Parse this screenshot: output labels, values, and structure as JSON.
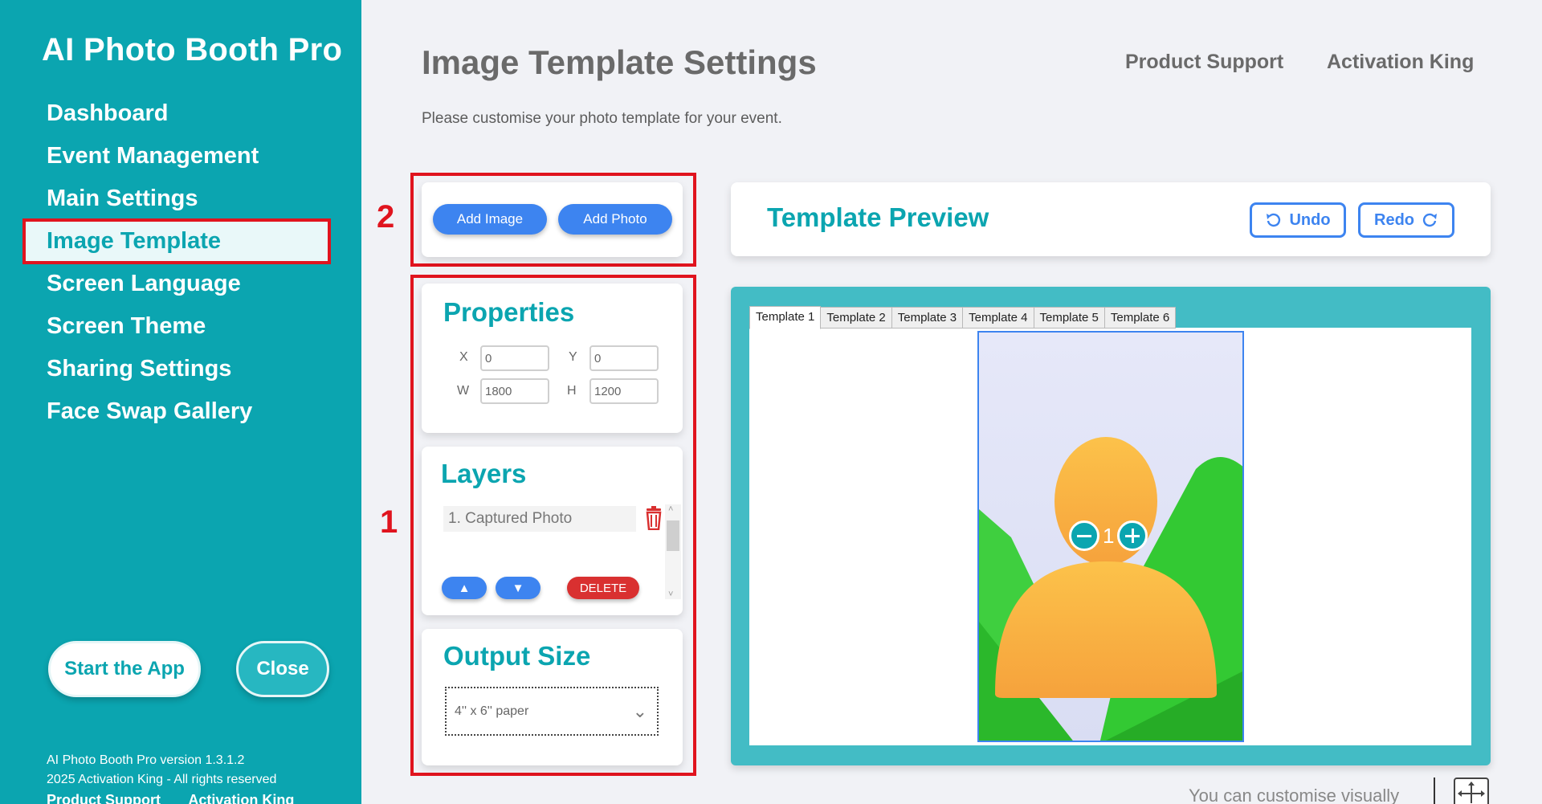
{
  "app": {
    "title": "AI Photo Booth Pro"
  },
  "sidebar": {
    "items": [
      {
        "label": "Dashboard"
      },
      {
        "label": "Event Management"
      },
      {
        "label": "Main Settings"
      },
      {
        "label": "Image Template",
        "active": true
      },
      {
        "label": "Screen Language"
      },
      {
        "label": "Screen Theme"
      },
      {
        "label": "Sharing Settings"
      },
      {
        "label": "Face Swap Gallery"
      }
    ],
    "start_label": "Start the App",
    "close_label": "Close",
    "version": "AI Photo Booth Pro version 1.3.1.2",
    "copyright": "2025 Activation King - All rights reserved",
    "footer_links": [
      "Product Support",
      "Activation King"
    ]
  },
  "header": {
    "title": "Image Template Settings",
    "subtitle": "Please customise your photo template for your event.",
    "links": [
      "Product Support",
      "Activation King"
    ]
  },
  "annotations": {
    "marker_1": "1",
    "marker_2": "2"
  },
  "actions": {
    "add_image": "Add Image",
    "add_photo": "Add Photo"
  },
  "properties": {
    "title": "Properties",
    "x_label": "X",
    "x_value": "0",
    "y_label": "Y",
    "y_value": "0",
    "w_label": "W",
    "w_value": "1800",
    "h_label": "H",
    "h_value": "1200"
  },
  "layers": {
    "title": "Layers",
    "items": [
      "1. Captured Photo"
    ],
    "up_label": "▲",
    "down_label": "▼",
    "delete_label": "DELETE"
  },
  "output": {
    "title": "Output Size",
    "selected": "4'' x 6'' paper"
  },
  "preview": {
    "title": "Template Preview",
    "undo_label": "Undo",
    "redo_label": "Redo",
    "tabs": [
      "Template 1",
      "Template 2",
      "Template 3",
      "Template 4",
      "Template 5",
      "Template 6"
    ],
    "active_tab": 0,
    "zoom_value": "1",
    "hint": "You can customise visually"
  },
  "colors": {
    "brand": "#0ba5b0",
    "accent": "#3d84f0",
    "danger": "#d93030",
    "annotation": "#e0141e"
  },
  "icons": [
    "trash-icon",
    "undo-icon",
    "redo-icon",
    "zoom-out-icon",
    "zoom-in-icon",
    "move-icon",
    "chevron-down-icon"
  ]
}
